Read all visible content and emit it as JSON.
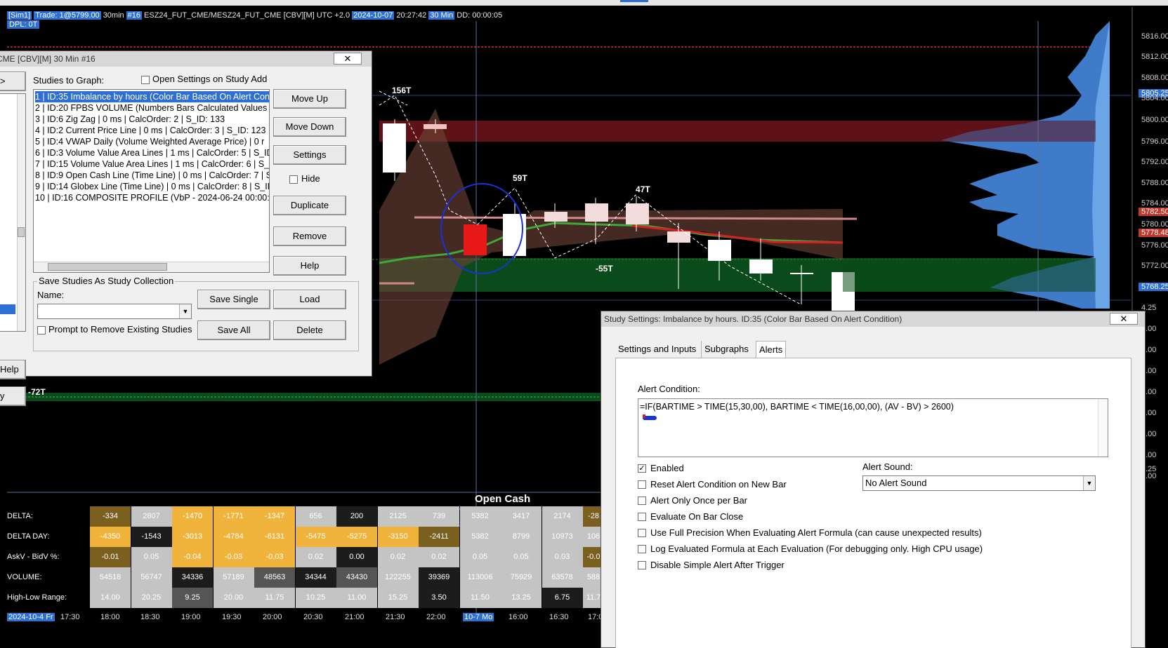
{
  "topbar": {
    "sim": "[Sim1]",
    "trade": "Trade: 1@5799.00",
    "interval": "30min",
    "chart_num": "#16",
    "symbol": "ESZ24_FUT_CME/MESZ24_FUT_CME [CBV][M] UTC +2.0",
    "date": "2024-10-07",
    "time": "20:27:42",
    "bar_period": "30 Min",
    "dd": "DD: 00:00:05",
    "dpl": "DPL: 0T"
  },
  "price_axis": {
    "labels": [
      "5816.00",
      "5812.00",
      "5808.00",
      "5805.25",
      "5804.00",
      "5800.00",
      "5796.00",
      "5792.00",
      "5788.00",
      "5784.00",
      "5782.50",
      "5780.00",
      "5778.48",
      "5776.00",
      "5772.00",
      "5768.25",
      "4.25",
      "0.00",
      "6.00",
      "2.00",
      "8.00",
      "4.00",
      "0.00",
      "6.00",
      "3.25",
      "2.00"
    ],
    "current_price": "5782.50",
    "vwap_price": "5778.48",
    "blue_price": "5805.25",
    "blue_price2": "5768.25"
  },
  "zigzag_labels": {
    "z1": "156T",
    "z2": "59T",
    "z3": "47T",
    "z4": "-55T",
    "z5": "-72T"
  },
  "open_cash_label": "Open Cash",
  "table": {
    "rows": [
      {
        "label": "DELTA:",
        "cells": [
          "-334",
          "2807",
          "-1470",
          "-1771",
          "-1347",
          "656",
          "200",
          "2125",
          "739",
          "5382",
          "3417",
          "2174",
          "-28"
        ]
      },
      {
        "label": "DELTA DAY:",
        "cells": [
          "-4350",
          "-1543",
          "-3013",
          "-4784",
          "-6131",
          "-5475",
          "-5275",
          "-3150",
          "-2411",
          "5382",
          "8799",
          "10973",
          "106"
        ]
      },
      {
        "label": "AskV - BidV %:",
        "cells": [
          "-0.01",
          "0.05",
          "-0.04",
          "-0.03",
          "-0.03",
          "0.02",
          "0.00",
          "0.02",
          "0.02",
          "0.05",
          "0.05",
          "0.03",
          "-0.0"
        ]
      },
      {
        "label": "VOLUME:",
        "cells": [
          "54518",
          "56747",
          "34336",
          "57189",
          "48563",
          "34344",
          "43430",
          "122255",
          "39369",
          "113006",
          "75929",
          "63578",
          "588"
        ]
      },
      {
        "label": "High-Low Range:",
        "cells": [
          "14.00",
          "20.25",
          "9.25",
          "20.00",
          "11.75",
          "10.25",
          "11.00",
          "15.25",
          "3.50",
          "11.50",
          "13.25",
          "6.75",
          "11.7"
        ]
      }
    ]
  },
  "time_axis": [
    "2024-10-4 Fr",
    "17:30",
    "18:00",
    "18:30",
    "19:00",
    "19:30",
    "20:00",
    "20:30",
    "21:00",
    "21:30",
    "22:00",
    "10-7 Mo",
    "16:00",
    "16:30",
    "17:0"
  ],
  "studies_dialog": {
    "title": "CME [CBV][M]  30 Min  #16",
    "studies_label": "Studies to Graph:",
    "open_settings_label": "Open Settings on Study Add",
    "studies": [
      "1 | ID:35  Imbalance by hours (Color Bar Based On Alert Con",
      "2 | ID:20  FPBS VOLUME (Numbers Bars Calculated Values",
      "3 | ID:6  Zig Zag | 0 ms | CalcOrder: 2 | S_ID: 133",
      "4 | ID:2  Current Price Line | 0 ms | CalcOrder: 3 | S_ID: 123",
      "5 | ID:4  VWAP Daily (Volume Weighted Average Price) | 0 r",
      "6 | ID:3  Volume Value Area Lines | 1 ms | CalcOrder: 5 | S_ID",
      "7 | ID:15  Volume Value Area Lines | 1 ms | CalcOrder: 6 | S_",
      "8 | ID:9  Open Cash Line (Time Line) | 0 ms | CalcOrder: 7 | S",
      "9 | ID:14  Globex Line (Time Line) | 0 ms | CalcOrder: 8 | S_ID",
      "10 | ID:16  COMPOSITE PROFILE (VbP - 2024-06-24  00:00:("
    ],
    "buttons": {
      "move_up": "Move Up",
      "move_down": "Move Down",
      "settings": "Settings",
      "hide": "Hide",
      "duplicate": "Duplicate",
      "remove": "Remove",
      "help": "Help",
      "save_single": "Save Single",
      "load": "Load",
      "save_all": "Save All",
      "delete": "Delete",
      "left_help": "Help",
      "left_y": "y",
      "left_gt": ">"
    },
    "collection_label": "Save Studies As Study Collection",
    "name_label": "Name:",
    "name_value": "",
    "prompt_remove_label": "Prompt to Remove Existing Studies"
  },
  "settings_dialog": {
    "title": "Study Settings: Imbalance by hours. ID:35 (Color Bar Based On Alert Condition)",
    "tabs": [
      "Settings and Inputs",
      "Subgraphs",
      "Alerts"
    ],
    "alert_condition_label": "Alert Condition:",
    "alert_formula": "=IF(BARTIME > TIME(15,30,00), BARTIME < TIME(16,00,00), (AV - BV) > 2600)",
    "options": [
      {
        "label": "Enabled",
        "checked": true
      },
      {
        "label": "Reset Alert Condition on New Bar",
        "checked": false
      },
      {
        "label": "Alert Only Once per Bar",
        "checked": false
      },
      {
        "label": "Evaluate On Bar Close",
        "checked": false
      },
      {
        "label": "Use Full Precision When Evaluating Alert Formula (can cause unexpected results)",
        "checked": false
      },
      {
        "label": "Log Evaluated Formula at Each Evaluation (For debugging only. High CPU usage)",
        "checked": false
      },
      {
        "label": "Disable Simple Alert After Trigger",
        "checked": false
      }
    ],
    "alert_sound_label": "Alert Sound:",
    "alert_sound_value": "No Alert Sound"
  },
  "colors": {
    "accent_blue": "#2d6fd2",
    "delta_neg": "#f0b43c",
    "delta_dark": "#7a5f1e",
    "cell_gray": "#c4c4c4",
    "cell_black": "#1c1c1c"
  }
}
